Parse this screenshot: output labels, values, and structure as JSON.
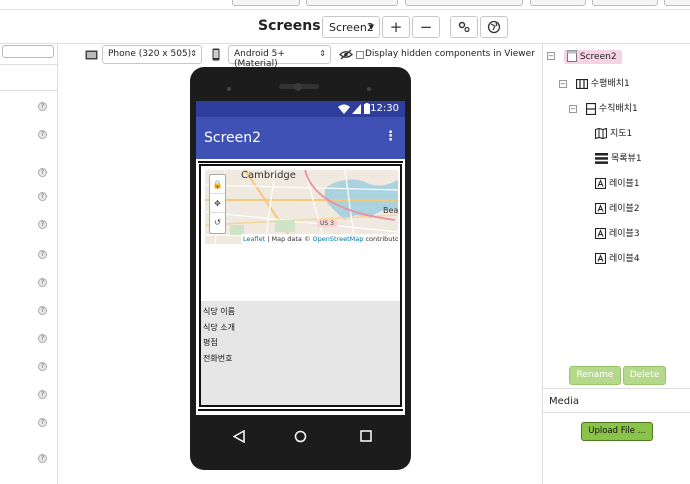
{
  "toolbar": {
    "screens_label": "Screens:",
    "screen_selected": "Screen2",
    "add_label": "+",
    "remove_label": "−"
  },
  "viewer": {
    "device_option": "Phone (320 x 505)",
    "theme_option": "Android 5+ (Material)",
    "hidden_components_label": "Display hidden components in Viewer"
  },
  "phone": {
    "status_time": "12:30",
    "app_title": "Screen2",
    "map": {
      "place_label": "Cambridge",
      "place_label_2": "Beaco",
      "road_badge": "US 3",
      "attribution_leaflet": "Leaflet",
      "attribution_middle": "| Map data ©",
      "attribution_osm": "OpenStreetMap",
      "attribution_end": "contributors"
    },
    "labels": [
      "식당 이름",
      "식당 소개",
      "평점",
      "전화번호"
    ]
  },
  "tree": {
    "items": [
      {
        "label": "Screen2",
        "level": 0
      },
      {
        "label": "수평배치1",
        "level": 1
      },
      {
        "label": "수직배치1",
        "level": 2
      },
      {
        "label": "지도1",
        "level": 3
      },
      {
        "label": "목록뷰1",
        "level": 3
      },
      {
        "label": "레이블1",
        "level": 3
      },
      {
        "label": "레이블2",
        "level": 3
      },
      {
        "label": "레이블3",
        "level": 3
      },
      {
        "label": "레이블4",
        "level": 3
      }
    ],
    "rename_label": "Rename",
    "delete_label": "Delete"
  },
  "media": {
    "title": "Media",
    "upload_label": "Upload File ..."
  },
  "colors": {
    "appbar": "#3f51b5",
    "statusbar": "#2f3d9c",
    "selected_item": "#f6d3e4",
    "upload_button": "#8bc34a"
  }
}
